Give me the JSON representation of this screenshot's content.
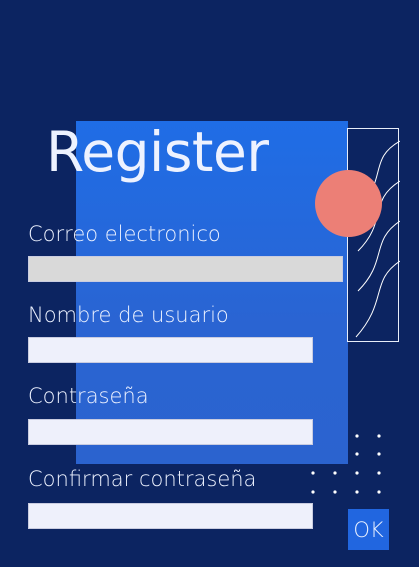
{
  "title": "Register",
  "form": {
    "email_label": "Correo electronico",
    "email_value": "",
    "username_label": "Nombre de usuario",
    "username_value": "",
    "password_label": "Contraseña",
    "password_value": "",
    "confirm_label": "Confirmar contraseña",
    "confirm_value": ""
  },
  "ok_label": "OK",
  "colors": {
    "background": "#0c2461",
    "panel": "#2166e0",
    "accent_circle": "#ec7f76",
    "text": "#edf2ff"
  }
}
